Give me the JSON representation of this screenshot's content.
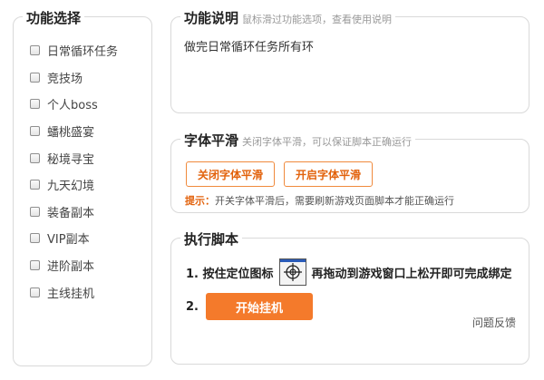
{
  "left_panel": {
    "title": "功能选择",
    "items": [
      {
        "label": "日常循环任务"
      },
      {
        "label": "竞技场"
      },
      {
        "label": "个人boss"
      },
      {
        "label": "蟠桃盛宴"
      },
      {
        "label": "秘境寻宝"
      },
      {
        "label": "九天幻境"
      },
      {
        "label": "装备副本"
      },
      {
        "label": "VIP副本"
      },
      {
        "label": "进阶副本"
      },
      {
        "label": "主线挂机"
      }
    ]
  },
  "desc_panel": {
    "title": "功能说明",
    "hint": "鼠标滑过功能选项，查看使用说明",
    "text": "做完日常循环任务所有环"
  },
  "font_panel": {
    "title": "字体平滑",
    "hint": "关闭字体平滑，可以保证脚本正确运行",
    "btn_off": "关闭字体平滑",
    "btn_on": "开启字体平滑",
    "tip_label": "提示：",
    "tip_text": "开关字体平滑后，需要刷新游戏页面脚本才能正确运行"
  },
  "run_panel": {
    "title": "执行脚本",
    "step1_prefix": "1. 按住定位图标",
    "step1_suffix": "再拖动到游戏窗口上松开即可完成绑定",
    "step2_prefix": "2.",
    "start_button": "开始挂机",
    "feedback": "问题反馈"
  },
  "colors": {
    "accent": "#f47a2b",
    "accent_text": "#e2620c",
    "border": "#d9d9d9"
  },
  "icons": {
    "target": "crosshair-target-icon"
  }
}
